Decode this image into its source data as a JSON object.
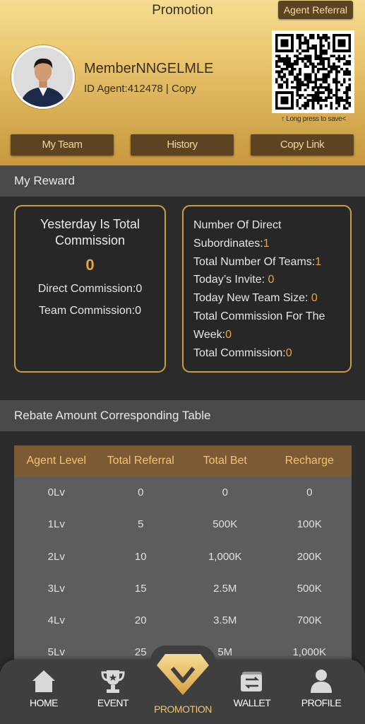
{
  "header": {
    "title": "Promotion",
    "agent_referral_label": "Agent Referral"
  },
  "member": {
    "name": "MemberNNGELMLE",
    "id_text": "ID Agent:412478",
    "separator": " | ",
    "copy_label": "Copy"
  },
  "qr": {
    "hint": "↑ Long press to save<"
  },
  "actions": {
    "my_team": "My Team",
    "history": "History",
    "copy_link": "Copy Link"
  },
  "my_reward": {
    "section_title": "My Reward",
    "yesterday_title": "Yesterday Is Total Commission",
    "yesterday_value": "0",
    "direct_commission": "Direct Commission:0",
    "team_commission": "Team Commission:0",
    "stats": {
      "direct_subordinates_label": "Number Of Direct Subordinates:",
      "direct_subordinates_value": "1",
      "total_teams_label": "Total Number Of Teams:",
      "total_teams_value": "1",
      "todays_invite_label": "Today’s Invite: ",
      "todays_invite_value": "0",
      "new_team_size_label": "Today New Team Size: ",
      "new_team_size_value": "0",
      "week_commission_label": "Total Commission For The Week:",
      "week_commission_value": "0",
      "total_commission_label": "Total Commission:",
      "total_commission_value": "0"
    }
  },
  "rebate": {
    "section_title": "Rebate Amount Corresponding Table",
    "columns": [
      "Agent Level",
      "Total Referral",
      "Total Bet",
      "Recharge"
    ],
    "rows": [
      [
        "0Lv",
        "0",
        "0",
        "0"
      ],
      [
        "1Lv",
        "5",
        "500K",
        "100K"
      ],
      [
        "2Lv",
        "10",
        "1,000K",
        "200K"
      ],
      [
        "3Lv",
        "15",
        "2.5M",
        "500K"
      ],
      [
        "4Lv",
        "20",
        "3.5M",
        "700K"
      ],
      [
        "5Lv",
        "25",
        "5M",
        "1,000K"
      ]
    ]
  },
  "nav": {
    "home": "HOME",
    "event": "EVENT",
    "promotion": "PROMOTION",
    "wallet": "WALLET",
    "profile": "PROFILE"
  },
  "colors": {
    "gold_accent": "#e6a643",
    "button_brown": "#5c4423",
    "table_header": "#7b5a34",
    "card_border": "#c99c48"
  }
}
